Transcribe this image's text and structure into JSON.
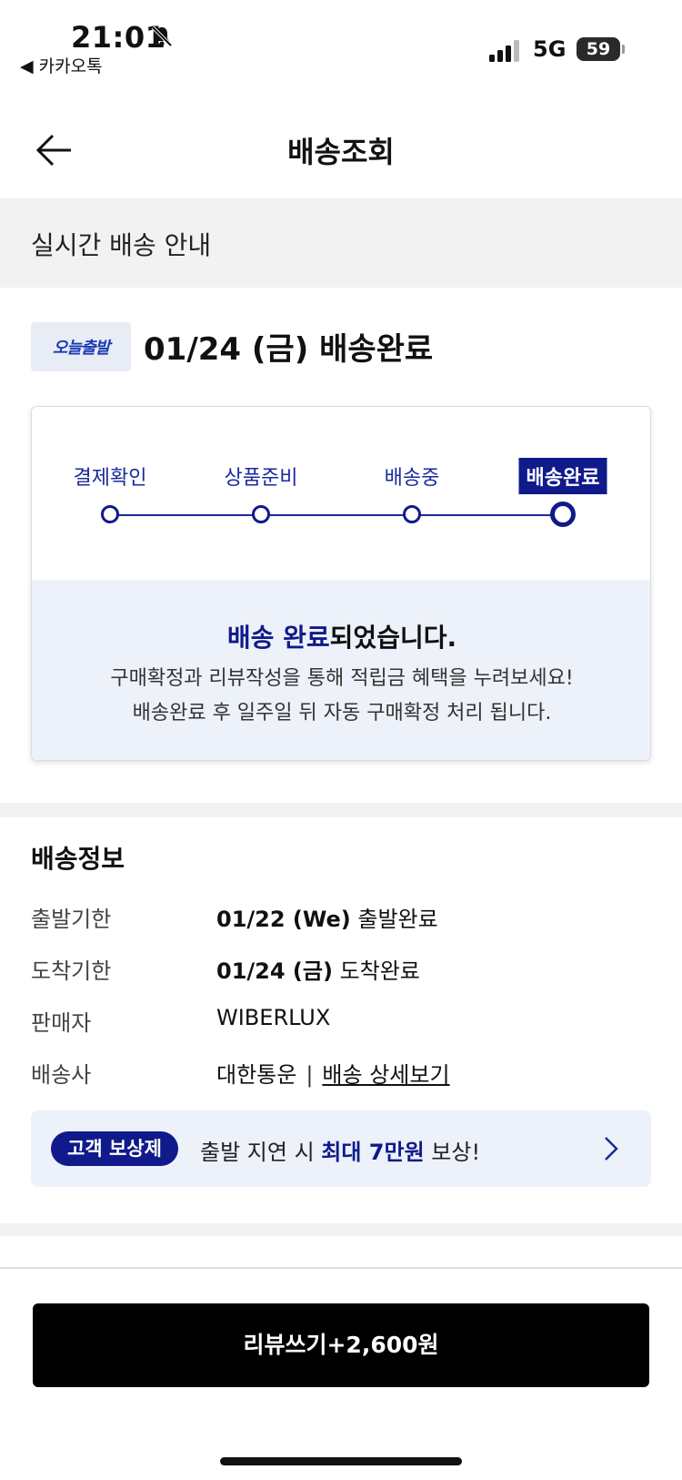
{
  "status_bar": {
    "time": "21:01",
    "back_app": "◀ 카카오톡",
    "network": "5G",
    "battery": "59"
  },
  "nav": {
    "title": "배송조회"
  },
  "info_band": {
    "text": "실시간 배송 안내"
  },
  "delivery": {
    "badge": "오늘출발",
    "headline": "01/24 (금) 배송완료"
  },
  "steps": [
    "결제확인",
    "상품준비",
    "배송중",
    "배송완료"
  ],
  "active_step": "배송완료",
  "message": {
    "title_accent": "배송 완료",
    "title_rest": "되었습니다.",
    "line1": "구매확정과 리뷰작성을 통해 적립금 혜택을 누려보세요!",
    "line2": "배송완료 후 일주일 뒤 자동 구매확정 처리 됩니다."
  },
  "shipping_info": {
    "title": "배송정보",
    "rows": [
      {
        "label": "출발기한",
        "value_bold": "01/22 (We)",
        "value_rest": " 출발완료"
      },
      {
        "label": "도착기한",
        "value_bold": "01/24 (금)",
        "value_rest": " 도착완료"
      },
      {
        "label": "판매자",
        "value": "WIBERLUX"
      },
      {
        "label": "배송사",
        "carrier": "대한통운",
        "separator": "|",
        "link": "배송 상세보기"
      }
    ]
  },
  "promo": {
    "pill": "고객 보상제",
    "text_pre": "출발 지연 시 ",
    "text_bold": "최대 7만원",
    "text_post": " 보상!"
  },
  "cta": {
    "label": "리뷰쓰기+2,600원"
  },
  "colors": {
    "accent_navy": "#101a8a",
    "light_blue_bg": "#edf1f9",
    "band_gray": "#f2f2f2"
  }
}
